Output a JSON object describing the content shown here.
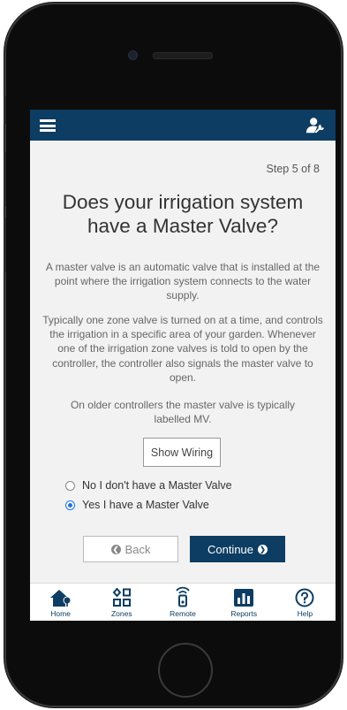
{
  "wizard": {
    "step": "Step 5 of 8",
    "title": "Does your irrigation system have a Master Valve?",
    "paragraphs": [
      "A master valve is an automatic valve that is installed at the point where the irrigation system connects to the water supply.",
      "Typically one zone valve is turned on at a time, and controls the irrigation in a specific area of your garden. Whenever one of the irrigation zone valves is told to open by the controller, the controller also signals the master valve to open.",
      "On older controllers the master valve is typically labelled MV."
    ],
    "show_wiring": "Show Wiring",
    "options": [
      {
        "label": "No I don't have a Master Valve",
        "selected": false
      },
      {
        "label": "Yes I have a Master Valve",
        "selected": true
      }
    ],
    "back": "Back",
    "continue": "Continue"
  },
  "tabs": [
    {
      "label": "Home",
      "icon": "home-icon"
    },
    {
      "label": "Zones",
      "icon": "zones-icon"
    },
    {
      "label": "Remote",
      "icon": "remote-icon"
    },
    {
      "label": "Reports",
      "icon": "reports-icon"
    },
    {
      "label": "Help",
      "icon": "help-icon"
    }
  ],
  "colors": {
    "brand": "#0d3d63",
    "radio_selected": "#1a73e8"
  }
}
